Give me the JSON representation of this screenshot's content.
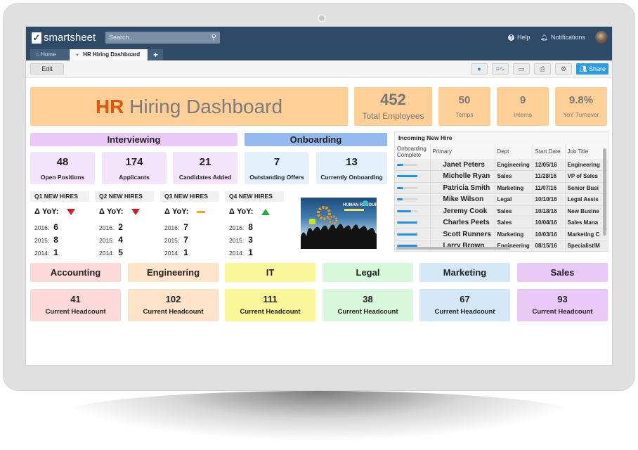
{
  "app": {
    "brand": "smartsheet",
    "search_placeholder": "Search...",
    "help_label": "Help",
    "notifications_label": "Notifications"
  },
  "tabs": [
    {
      "label": "Home",
      "active": false
    },
    {
      "label": "HR Hiring Dashboard",
      "active": true
    }
  ],
  "toolbar": {
    "edit_label": "Edit",
    "share_label": "Share",
    "icons": [
      "globe-icon",
      "activity-icon",
      "presentation-icon",
      "print-icon",
      "settings-icon"
    ]
  },
  "dashboard": {
    "title_accent": "HR",
    "title_rest": " Hiring Dashboard",
    "kpis": [
      {
        "value": "452",
        "label": "Total Employees"
      },
      {
        "value": "50",
        "label": "Temps"
      },
      {
        "value": "9",
        "label": "Interns"
      },
      {
        "value": "9.8%",
        "label": "YoY Turnover"
      }
    ],
    "interviewing": {
      "title": "Interviewing",
      "stats": [
        {
          "value": "48",
          "label": "Open Positions"
        },
        {
          "value": "174",
          "label": "Applicants"
        },
        {
          "value": "21",
          "label": "Candidates Added"
        }
      ]
    },
    "onboarding": {
      "title": "Onboarding",
      "stats": [
        {
          "value": "7",
          "label": "Outstanding Offers"
        },
        {
          "value": "13",
          "label": "Currently Onboarding"
        }
      ]
    },
    "quarters": [
      {
        "title": "Q1 NEW HIRES",
        "yoy_label": "Δ YoY:",
        "trend": "down",
        "years": [
          {
            "year": "2016:",
            "value": "6"
          },
          {
            "year": "2015:",
            "value": "8"
          },
          {
            "year": "2014:",
            "value": "1"
          }
        ]
      },
      {
        "title": "Q2 NEW HIRES",
        "yoy_label": "Δ YoY:",
        "trend": "down",
        "years": [
          {
            "year": "2016:",
            "value": "2"
          },
          {
            "year": "2015:",
            "value": "4"
          },
          {
            "year": "2014:",
            "value": "5"
          }
        ]
      },
      {
        "title": "Q3 NEW HIRES",
        "yoy_label": "Δ YoY:",
        "trend": "flat",
        "years": [
          {
            "year": "2016:",
            "value": "7"
          },
          {
            "year": "2015:",
            "value": "7"
          },
          {
            "year": "2014:",
            "value": "1"
          }
        ]
      },
      {
        "title": "Q4 NEW HIRES",
        "yoy_label": "Δ YoY:",
        "trend": "up",
        "years": [
          {
            "year": "2016:",
            "value": "8"
          },
          {
            "year": "2015:",
            "value": "3"
          },
          {
            "year": "2014:",
            "value": "1"
          }
        ]
      }
    ],
    "image_label": "HUMAN RESOURCES",
    "new_hire_grid": {
      "title": "Incoming New Hire",
      "columns": [
        "Onboarding Complete",
        "Primary",
        "Dept",
        "Start Date",
        "Job Title"
      ],
      "rows": [
        {
          "progress": 0.3,
          "name": "Janet Peters",
          "dept": "Engineering",
          "start": "12/05/16",
          "title": "Engineering"
        },
        {
          "progress": 0.95,
          "name": "Michelle Ryan",
          "dept": "Sales",
          "start": "11/28/16",
          "title": "VP of Sales"
        },
        {
          "progress": 0.3,
          "name": "Patricia Smith",
          "dept": "Marketing",
          "start": "11/07/16",
          "title": "Senior Busi"
        },
        {
          "progress": 0.25,
          "name": "Mike Wilson",
          "dept": "Legal",
          "start": "10/10/16",
          "title": "Legal Assis"
        },
        {
          "progress": 0.65,
          "name": "Jeremy Cook",
          "dept": "Sales",
          "start": "10/18/16",
          "title": "New Busine"
        },
        {
          "progress": 0.95,
          "name": "Charles Peets",
          "dept": "Sales",
          "start": "10/04/16",
          "title": "Sales Mana"
        },
        {
          "progress": 0.95,
          "name": "Scott Runners",
          "dept": "Marketing",
          "start": "10/03/16",
          "title": "Marketing C"
        },
        {
          "progress": 0.95,
          "name": "Larry Brown",
          "dept": "Engineering",
          "start": "08/15/16",
          "title": "Specialist/M"
        }
      ]
    },
    "departments": [
      {
        "name": "Accounting",
        "value": "41",
        "label": "Current Headcount",
        "head_color": "#fcd9d9",
        "card_color": "#fcd9d9"
      },
      {
        "name": "Engineering",
        "value": "102",
        "label": "Current Headcount",
        "head_color": "#fde3c8",
        "card_color": "#fde3c8"
      },
      {
        "name": "IT",
        "value": "111",
        "label": "Current Headcount",
        "head_color": "#faf699",
        "card_color": "#faf699"
      },
      {
        "name": "Legal",
        "value": "38",
        "label": "Current Headcount",
        "head_color": "#d8f8dc",
        "card_color": "#d8f8dc"
      },
      {
        "name": "Marketing",
        "value": "67",
        "label": "Current Headcount",
        "head_color": "#d4e7f6",
        "card_color": "#d4e7f6"
      },
      {
        "name": "Sales",
        "value": "93",
        "label": "Current Headcount",
        "head_color": "#ebc9f7",
        "card_color": "#ebc9f7"
      }
    ],
    "colors": {
      "interviewing_head": "#ebc9f7",
      "interviewing_card": "#f4e4fb",
      "onboarding_head": "#93b9ef",
      "onboarding_card": "#e4f1fc",
      "kpi": "#fecf97",
      "title_accent": "#d8580d",
      "topbar": "#2e4a67",
      "share": "#2c9be0"
    }
  }
}
